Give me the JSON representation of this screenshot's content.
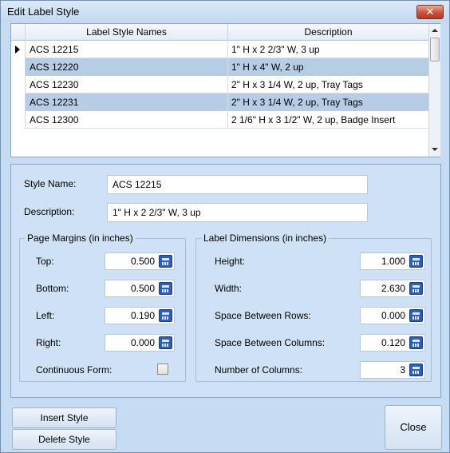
{
  "window": {
    "title": "Edit Label Style",
    "close_glyph": "✕"
  },
  "grid": {
    "headers": [
      "Label Style Names",
      "Description"
    ],
    "rows": [
      {
        "name": "ACS 12215",
        "description": "1\" H x 2 2/3\" W, 3 up"
      },
      {
        "name": "ACS 12220",
        "description": "1\" H x 4\" W, 2 up"
      },
      {
        "name": "ACS 12230",
        "description": "2\" H x 3 1/4 W, 2 up, Tray Tags"
      },
      {
        "name": "ACS 12231",
        "description": "2\" H x 3 1/4 W, 2 up, Tray Tags"
      },
      {
        "name": "ACS 12300",
        "description": "2 1/6\" H x 3 1/2\" W, 2 up, Badge Insert"
      }
    ]
  },
  "form": {
    "style_name_label": "Style Name:",
    "style_name_value": "ACS 12215",
    "description_label": "Description:",
    "description_value": "1\" H x 2 2/3\" W, 3 up"
  },
  "margins": {
    "title": "Page Margins (in inches)",
    "top_label": "Top:",
    "top_value": "0.500",
    "bottom_label": "Bottom:",
    "bottom_value": "0.500",
    "left_label": "Left:",
    "left_value": "0.190",
    "right_label": "Right:",
    "right_value": "0.000",
    "continuous_label": "Continuous Form:"
  },
  "dimensions": {
    "title": "Label Dimensions (in inches)",
    "height_label": "Height:",
    "height_value": "1.000",
    "width_label": "Width:",
    "width_value": "2.630",
    "rows_label": "Space Between Rows:",
    "rows_value": "0.000",
    "cols_label": "Space Between Columns:",
    "cols_value": "0.120",
    "ncols_label": "Number of Columns:",
    "ncols_value": "3"
  },
  "buttons": {
    "insert": "Insert Style",
    "delete": "Delete Style",
    "close": "Close"
  },
  "colors": {
    "window_bg": "#c6dcf3",
    "selected_row": "#b7cde6",
    "close_red": "#c9533b"
  }
}
